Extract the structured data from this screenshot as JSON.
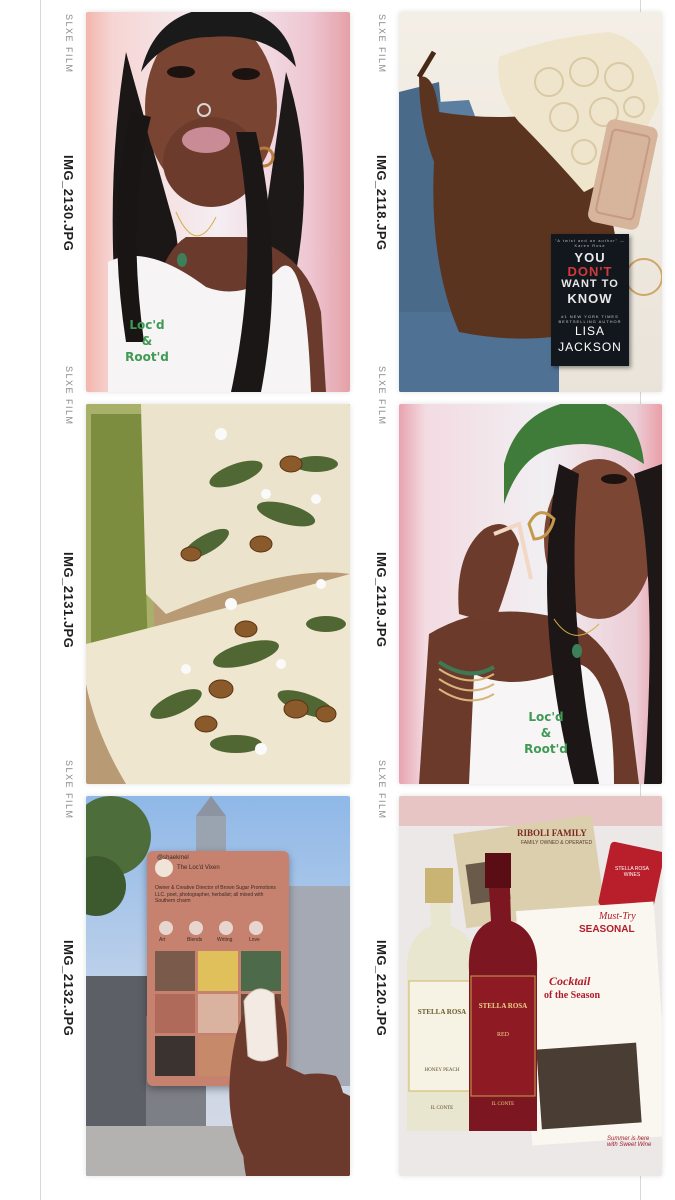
{
  "film_brand": "SLXE FILM",
  "brand_colors": {
    "accent_pink": "#f3b3b8",
    "shirt_green": "#3f9a54",
    "wine_red": "#8e1b24"
  },
  "frames": [
    {
      "label": "IMG_2130.JPG",
      "shirt_line1": "Loc'd",
      "shirt_line2": "&",
      "shirt_line3": "Root'd"
    },
    {
      "label": "IMG_2118.JPG",
      "book_blurb": "\"A twist and an author\" —Karen Rose",
      "book_title_1": "YOU",
      "book_title_2": "DON'T",
      "book_title_3": "WANT TO",
      "book_title_4": "KNOW",
      "book_tag": "#1 NEW YORK TIMES BESTSELLING AUTHOR",
      "book_author_1": "LISA",
      "book_author_2": "JACKSON"
    },
    {
      "label": "IMG_2131.JPG"
    },
    {
      "label": "IMG_2119.JPG",
      "shirt_line1": "Loc'd",
      "shirt_line2": "&",
      "shirt_line3": "Root'd"
    },
    {
      "label": "IMG_2132.JPG",
      "card_handle": "@shaekmel",
      "card_name": "The Loc'd Vixen",
      "card_bio": "Owner & Creative Director of Brown Sugar Promotions LLC. poet, photographer, herbalist; all mixed with Southern charm",
      "card_hl1": "Art",
      "card_hl2": "Blends",
      "card_hl3": "Writing",
      "card_hl4": "Love"
    },
    {
      "label": "IMG_2120.JPG",
      "riboli": "RIBOLI FAMILY",
      "riboli_sub": "FAMILY OWNED & OPERATED",
      "stella_card": "STELLA ROSA WINES",
      "bottle1_brand": "STELLA ROSA",
      "bottle1_flavor": "HONEY PEACH",
      "bottle1_maker": "IL CONTE",
      "bottle2_brand": "STELLA ROSA",
      "bottle2_flavor": "RED",
      "bottle2_maker": "IL CONTE",
      "mag_seasonal": "SEASONAL",
      "mag_must": "Must-Try",
      "mag_cocktail": "Cocktail",
      "mag_season": "of the Season",
      "mag_summer": "Summer is here with Sweet Wine"
    }
  ]
}
